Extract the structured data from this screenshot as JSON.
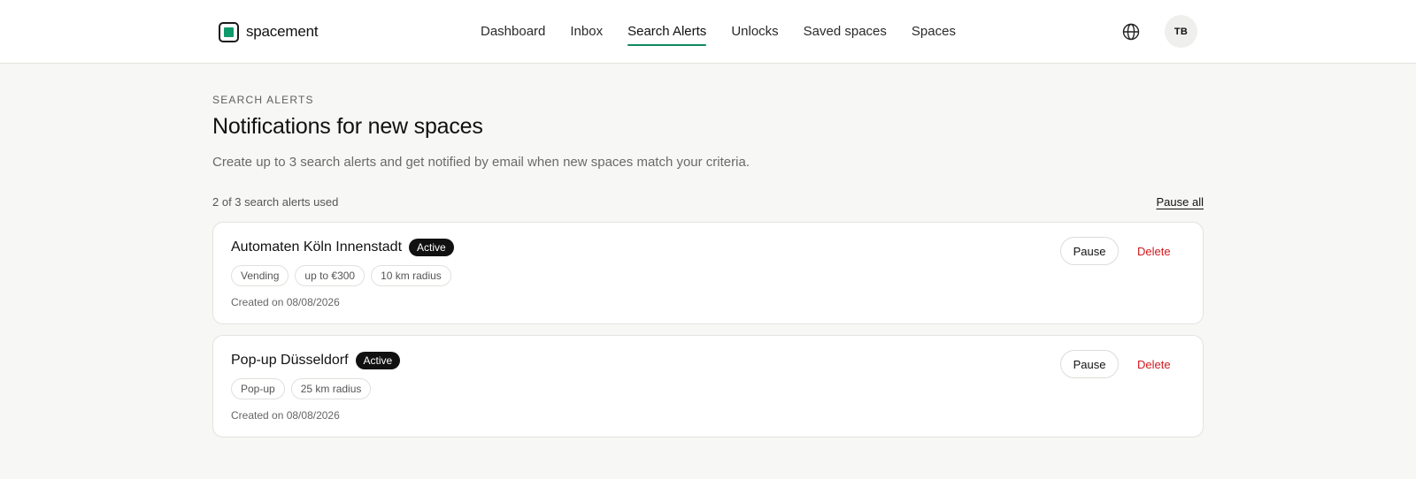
{
  "header": {
    "logo_text": "spacement",
    "brand_color": "#0f9a6a",
    "nav": [
      {
        "label": "Dashboard",
        "active": false
      },
      {
        "label": "Inbox",
        "active": false
      },
      {
        "label": "Search Alerts",
        "active": true
      },
      {
        "label": "Unlocks",
        "active": false
      },
      {
        "label": "Saved spaces",
        "active": false
      },
      {
        "label": "Spaces",
        "active": false
      }
    ],
    "language_icon": "globe-icon",
    "avatar_initials": "TB"
  },
  "page": {
    "eyebrow": "SEARCH ALERTS",
    "title": "Notifications for new spaces",
    "subtitle": "Create up to 3 search alerts and get notified by email when new spaces match your criteria.",
    "usage": "2 of 3 search alerts used",
    "pause_all_label": "Pause all"
  },
  "alerts": [
    {
      "title": "Automaten Köln Innenstadt",
      "status": "Active",
      "chips": [
        "Vending",
        "up to €300",
        "10 km radius"
      ],
      "created": "Created on 08/08/2026",
      "pause_label": "Pause",
      "delete_label": "Delete"
    },
    {
      "title": "Pop-up Düsseldorf",
      "status": "Active",
      "chips": [
        "Pop-up",
        "25 km radius"
      ],
      "created": "Created on 08/08/2026",
      "pause_label": "Pause",
      "delete_label": "Delete"
    }
  ],
  "colors": {
    "accent_underline": "#0f8a5f",
    "delete_text": "#d0191f",
    "badge_bg": "#111111"
  }
}
